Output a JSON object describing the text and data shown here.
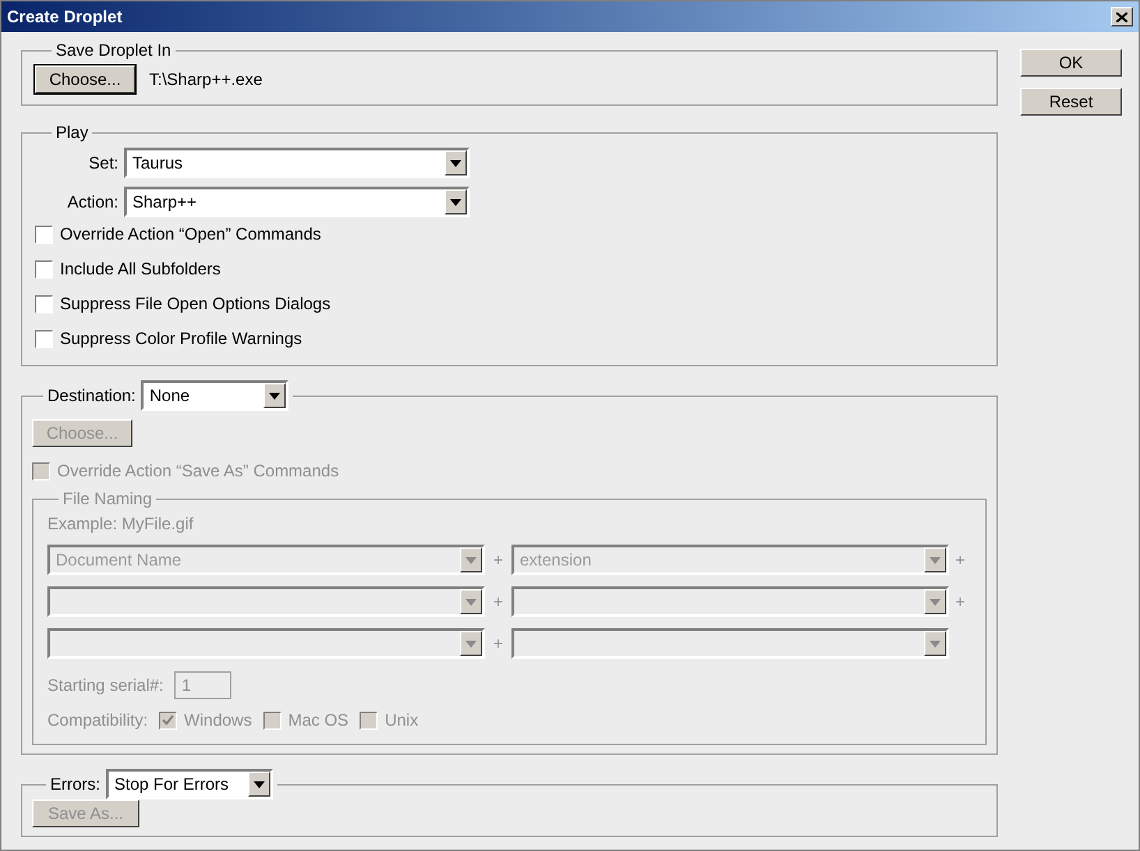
{
  "window": {
    "title": "Create Droplet"
  },
  "save_droplet_in": {
    "legend": "Save Droplet In",
    "choose_button": {
      "label": "Choose...",
      "disabled": false
    },
    "path": "T:\\Sharp++.exe"
  },
  "play": {
    "legend": "Play",
    "set": {
      "label": "Set:",
      "value": "Taurus"
    },
    "action": {
      "label": "Action:",
      "value": "Sharp++"
    },
    "options": [
      {
        "label": "Override Action “Open” Commands",
        "checked": false
      },
      {
        "label": "Include All Subfolders",
        "checked": false
      },
      {
        "label": "Suppress File Open Options Dialogs",
        "checked": false
      },
      {
        "label": "Suppress Color Profile Warnings",
        "checked": false
      }
    ]
  },
  "destination": {
    "label": "Destination:",
    "value": "None",
    "choose_button": {
      "label": "Choose...",
      "disabled": true
    },
    "override": {
      "label": "Override Action “Save As” Commands",
      "checked": false,
      "disabled": true
    },
    "file_naming": {
      "legend": "File Naming",
      "example": "Example: MyFile.gif",
      "rows": [
        {
          "fields": [
            {
              "value": "Document Name"
            },
            {
              "value": "extension"
            }
          ],
          "separators": [
            "+",
            "+"
          ]
        },
        {
          "separators": [
            "+",
            "+"
          ]
        },
        {
          "separators": [
            "+"
          ]
        }
      ],
      "serial": {
        "label": "Starting serial#:",
        "value": "1"
      },
      "compatibility": {
        "label": "Compatibility:",
        "options": [
          {
            "label": "Windows",
            "checked": true
          },
          {
            "label": "Mac OS",
            "checked": false
          },
          {
            "label": "Unix",
            "checked": false
          }
        ]
      }
    }
  },
  "errors": {
    "label": "Errors:",
    "value": "Stop For Errors",
    "save_as_button": {
      "label": "Save As...",
      "disabled": true
    }
  },
  "buttons": [
    "OK",
    "Reset"
  ]
}
